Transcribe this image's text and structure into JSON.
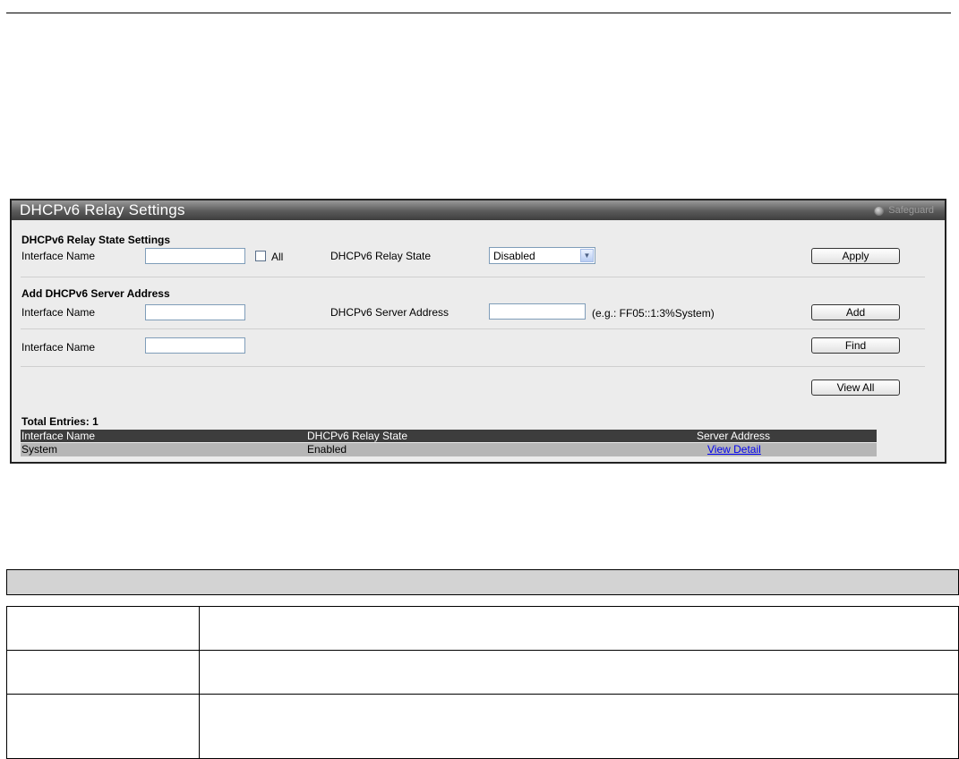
{
  "panel": {
    "title": "DHCPv6 Relay Settings",
    "safeguard": "Safeguard"
  },
  "state_section": {
    "heading": "DHCPv6 Relay State Settings",
    "interface_label": "Interface Name",
    "interface_value": "",
    "all_label": "All",
    "all_checked": false,
    "relay_state_label": "DHCPv6 Relay State",
    "relay_state_value": "Disabled",
    "apply_label": "Apply"
  },
  "server_section": {
    "heading": "Add DHCPv6 Server Address",
    "interface_label": "Interface Name",
    "interface_value": "",
    "server_label": "DHCPv6 Server Address",
    "server_value": "",
    "example": "(e.g.: FF05::1:3%System)",
    "add_label": "Add"
  },
  "find_section": {
    "interface_label": "Interface Name",
    "interface_value": "",
    "find_label": "Find",
    "view_all_label": "View All"
  },
  "table": {
    "total_entries": "Total Entries: 1",
    "headers": [
      "Interface Name",
      "DHCPv6 Relay State",
      "Server Address"
    ],
    "rows": [
      {
        "interface": "System",
        "state": "Enabled",
        "action": "View Detail"
      }
    ]
  },
  "colors": {
    "header_bg": "#3d3d3d",
    "row_bg": "#b6b6b6",
    "panel_bg": "#ececec",
    "link": "#0000ee"
  }
}
